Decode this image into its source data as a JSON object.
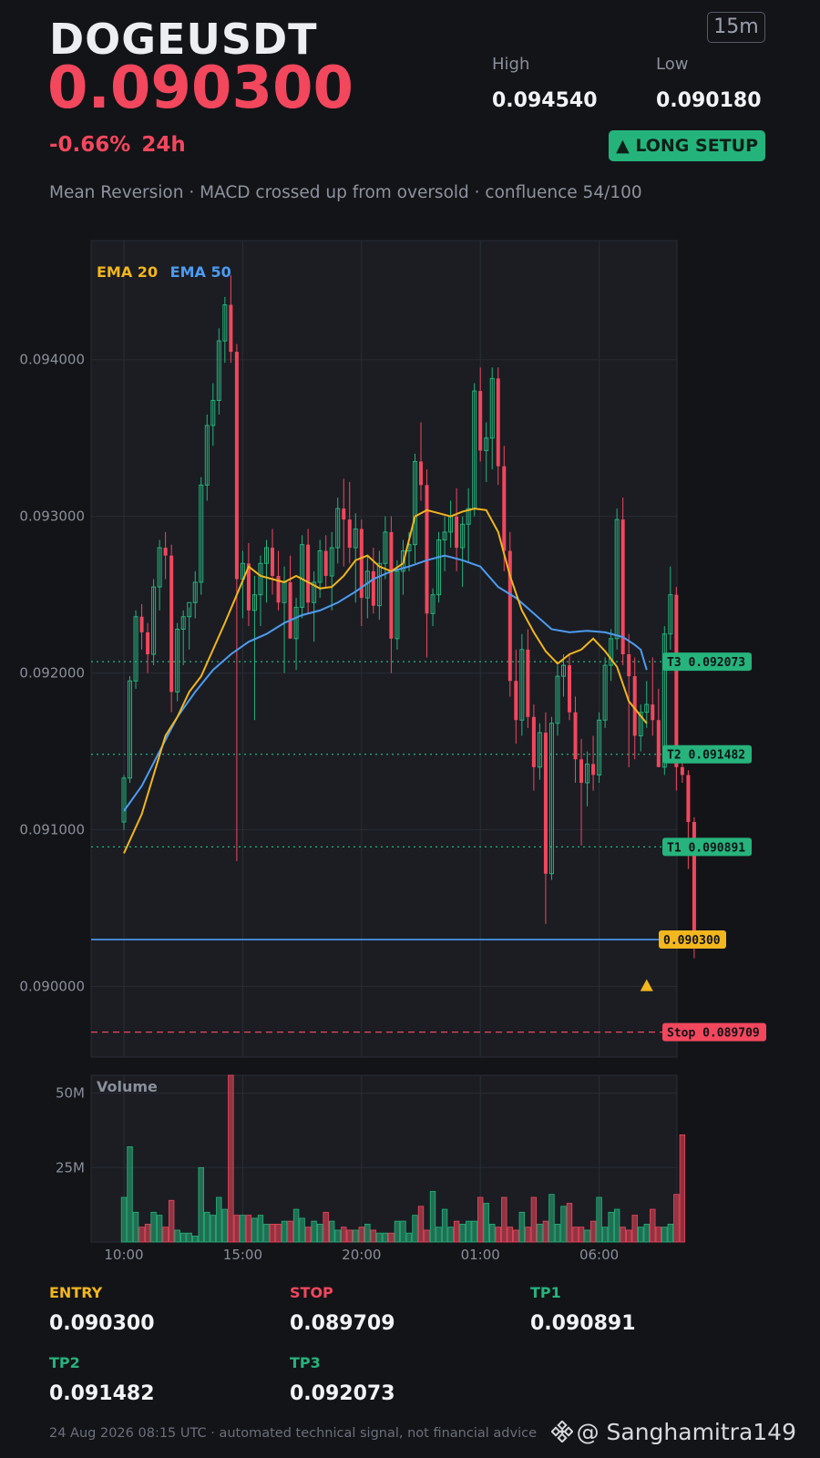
{
  "header": {
    "symbol": "DOGEUSDT",
    "price": "0.090300",
    "change": "-0.66%  24h",
    "timeframe": "15m",
    "high_label": "High",
    "high_value": "0.094540",
    "low_label": "Low",
    "low_value": "0.090180",
    "setup_badge": "▲ LONG SETUP",
    "strategy": "Mean Reversion · MACD crossed up from oversold · confluence 54/100"
  },
  "colors": {
    "up": "#26b37c",
    "down": "#f2475d",
    "ema20": "#f2b61e",
    "ema50": "#4d9cf2",
    "background": "#131418",
    "panel": "#1b1d23"
  },
  "chart_data": {
    "type": "candlestick",
    "y_ticks": [
      0.094,
      0.093,
      0.092,
      0.091,
      0.09
    ],
    "y_tick_labels": [
      "0.094000",
      "0.093000",
      "0.092000",
      "0.091000",
      "0.090000"
    ],
    "ylim": [
      0.08955,
      0.09476
    ],
    "x_tick_labels": [
      "10:00",
      "15:00",
      "20:00",
      "01:00",
      "06:00"
    ],
    "x_tick_index": [
      0,
      20,
      40,
      60,
      80
    ],
    "grid": true,
    "legend": [
      "EMA 20",
      "EMA 50"
    ],
    "candles_ohlc": [
      [
        0.09105,
        0.09135,
        0.091,
        0.09133
      ],
      [
        0.09133,
        0.09198,
        0.0913,
        0.09195
      ],
      [
        0.09195,
        0.0924,
        0.0919,
        0.09236
      ],
      [
        0.09236,
        0.09244,
        0.09215,
        0.09226
      ],
      [
        0.09226,
        0.09232,
        0.092,
        0.09212
      ],
      [
        0.09212,
        0.0926,
        0.09205,
        0.09255
      ],
      [
        0.09255,
        0.09285,
        0.0924,
        0.0928
      ],
      [
        0.0928,
        0.0929,
        0.0926,
        0.09275
      ],
      [
        0.09275,
        0.09282,
        0.09175,
        0.09188
      ],
      [
        0.09188,
        0.09232,
        0.09182,
        0.09228
      ],
      [
        0.09228,
        0.0924,
        0.09205,
        0.09236
      ],
      [
        0.09236,
        0.09242,
        0.09215,
        0.09245
      ],
      [
        0.09245,
        0.09265,
        0.09235,
        0.09258
      ],
      [
        0.09258,
        0.09325,
        0.0925,
        0.0932
      ],
      [
        0.0932,
        0.09365,
        0.0931,
        0.09358
      ],
      [
        0.09358,
        0.09385,
        0.09345,
        0.09374
      ],
      [
        0.09374,
        0.0942,
        0.09365,
        0.09412
      ],
      [
        0.09412,
        0.0944,
        0.09398,
        0.09435
      ],
      [
        0.09435,
        0.09454,
        0.09398,
        0.09405
      ],
      [
        0.09405,
        0.0941,
        0.0908,
        0.0926
      ],
      [
        0.0926,
        0.09278,
        0.09235,
        0.0927
      ],
      [
        0.0927,
        0.09283,
        0.0923,
        0.0924
      ],
      [
        0.0924,
        0.09262,
        0.0917,
        0.0925
      ],
      [
        0.0925,
        0.09275,
        0.0923,
        0.0927
      ],
      [
        0.0927,
        0.09285,
        0.09245,
        0.0928
      ],
      [
        0.0928,
        0.09292,
        0.0925,
        0.09262
      ],
      [
        0.09262,
        0.09278,
        0.0924,
        0.09245
      ],
      [
        0.09245,
        0.09268,
        0.092,
        0.09258
      ],
      [
        0.09258,
        0.09275,
        0.09235,
        0.09222
      ],
      [
        0.09222,
        0.09248,
        0.09202,
        0.09242
      ],
      [
        0.09242,
        0.09288,
        0.09235,
        0.09282
      ],
      [
        0.09282,
        0.09292,
        0.09238,
        0.09245
      ],
      [
        0.09245,
        0.09265,
        0.0922,
        0.09258
      ],
      [
        0.09258,
        0.09285,
        0.09248,
        0.09278
      ],
      [
        0.09278,
        0.09288,
        0.09255,
        0.09262
      ],
      [
        0.09262,
        0.0929,
        0.0924,
        0.0928
      ],
      [
        0.0928,
        0.09312,
        0.0927,
        0.09305
      ],
      [
        0.09305,
        0.09324,
        0.09268,
        0.09298
      ],
      [
        0.09298,
        0.09322,
        0.0927,
        0.0928
      ],
      [
        0.0928,
        0.09302,
        0.09245,
        0.09292
      ],
      [
        0.09292,
        0.09298,
        0.0923,
        0.09248
      ],
      [
        0.09248,
        0.09275,
        0.09235,
        0.09265
      ],
      [
        0.09265,
        0.0928,
        0.09238,
        0.09243
      ],
      [
        0.09243,
        0.09278,
        0.09234,
        0.0927
      ],
      [
        0.0927,
        0.093,
        0.0926,
        0.0929
      ],
      [
        0.0929,
        0.093,
        0.092,
        0.09222
      ],
      [
        0.09222,
        0.09272,
        0.09215,
        0.09265
      ],
      [
        0.09265,
        0.09285,
        0.0925,
        0.09278
      ],
      [
        0.09278,
        0.0929,
        0.09265,
        0.09282
      ],
      [
        0.09282,
        0.0934,
        0.0927,
        0.09335
      ],
      [
        0.09335,
        0.0936,
        0.0931,
        0.0932
      ],
      [
        0.0932,
        0.0933,
        0.0921,
        0.09238
      ],
      [
        0.09238,
        0.09254,
        0.0923,
        0.0925
      ],
      [
        0.0925,
        0.0929,
        0.09245,
        0.09285
      ],
      [
        0.09285,
        0.093,
        0.09265,
        0.0929
      ],
      [
        0.0929,
        0.0931,
        0.0928,
        0.093
      ],
      [
        0.093,
        0.09318,
        0.09265,
        0.0928
      ],
      [
        0.0928,
        0.093,
        0.09255,
        0.09295
      ],
      [
        0.09295,
        0.09318,
        0.0927,
        0.09305
      ],
      [
        0.09305,
        0.09385,
        0.093,
        0.0938
      ],
      [
        0.0938,
        0.09395,
        0.09335,
        0.09342
      ],
      [
        0.09342,
        0.0936,
        0.09322,
        0.0935
      ],
      [
        0.0935,
        0.09395,
        0.0933,
        0.09388
      ],
      [
        0.09388,
        0.09395,
        0.0932,
        0.09332
      ],
      [
        0.09332,
        0.09345,
        0.09265,
        0.09278
      ],
      [
        0.09278,
        0.0929,
        0.09185,
        0.09195
      ],
      [
        0.09195,
        0.09215,
        0.09155,
        0.0917
      ],
      [
        0.0917,
        0.09225,
        0.0916,
        0.09215
      ],
      [
        0.09215,
        0.09228,
        0.09165,
        0.09172
      ],
      [
        0.09172,
        0.0918,
        0.09125,
        0.0914
      ],
      [
        0.0914,
        0.09168,
        0.09132,
        0.09162
      ],
      [
        0.09162,
        0.09175,
        0.0904,
        0.09072
      ],
      [
        0.09072,
        0.09172,
        0.09068,
        0.09168
      ],
      [
        0.09168,
        0.09205,
        0.0916,
        0.09198
      ],
      [
        0.09198,
        0.09212,
        0.09185,
        0.09205
      ],
      [
        0.09205,
        0.09212,
        0.0917,
        0.09175
      ],
      [
        0.09175,
        0.09185,
        0.0913,
        0.09145
      ],
      [
        0.09145,
        0.09158,
        0.0909,
        0.0913
      ],
      [
        0.0913,
        0.0915,
        0.09115,
        0.09142
      ],
      [
        0.09142,
        0.0916,
        0.09125,
        0.09135
      ],
      [
        0.09135,
        0.09175,
        0.0913,
        0.0917
      ],
      [
        0.0917,
        0.0921,
        0.09165,
        0.09205
      ],
      [
        0.09205,
        0.09228,
        0.09195,
        0.09222
      ],
      [
        0.09222,
        0.09305,
        0.09215,
        0.09298
      ],
      [
        0.09298,
        0.09312,
        0.09205,
        0.09212
      ],
      [
        0.09212,
        0.09225,
        0.0914,
        0.09198
      ],
      [
        0.09198,
        0.0921,
        0.09145,
        0.0916
      ],
      [
        0.0916,
        0.0918,
        0.0915,
        0.09175
      ],
      [
        0.09175,
        0.09195,
        0.09165,
        0.0918
      ],
      [
        0.0918,
        0.0921,
        0.0916,
        0.0917
      ],
      [
        0.0917,
        0.0919,
        0.09145,
        0.0914
      ],
      [
        0.0914,
        0.0923,
        0.09135,
        0.09225
      ],
      [
        0.09225,
        0.09268,
        0.09215,
        0.0925
      ],
      [
        0.0925,
        0.09255,
        0.09125,
        0.0914
      ],
      [
        0.0914,
        0.09145,
        0.0913,
        0.09135
      ],
      [
        0.09135,
        0.09138,
        0.09075,
        0.09105
      ],
      [
        0.09105,
        0.09108,
        0.09018,
        0.0903
      ]
    ],
    "ema20": [
      0.09085,
      0.0911,
      0.09135,
      0.0916,
      0.09172,
      0.09188,
      0.09198,
      0.09215,
      0.09232,
      0.0925,
      0.09268,
      0.09262,
      0.0926,
      0.09258,
      0.09262,
      0.09258,
      0.09254,
      0.09255,
      0.09262,
      0.09272,
      0.09275,
      0.09268,
      0.09265,
      0.0927,
      0.093,
      0.09304,
      0.09302,
      0.093,
      0.09303,
      0.09305,
      0.09304,
      0.0929,
      0.09262,
      0.0924,
      0.09226,
      0.09214,
      0.09206,
      0.09212,
      0.09215,
      0.09222,
      0.09214,
      0.09204,
      0.09182,
      0.09168
    ],
    "ema20_x_index": [
      0,
      3,
      5,
      7,
      9,
      11,
      13,
      15,
      17,
      19,
      21,
      23,
      25,
      27,
      29,
      31,
      33,
      35,
      37,
      39,
      41,
      43,
      45,
      47,
      49,
      51,
      53,
      55,
      57,
      59,
      61,
      63,
      65,
      67,
      69,
      71,
      73,
      75,
      77,
      79,
      81,
      83,
      85,
      88
    ],
    "ema50": [
      0.09112,
      0.09128,
      0.0915,
      0.09172,
      0.09188,
      0.09202,
      0.09212,
      0.0922,
      0.09225,
      0.09232,
      0.09237,
      0.0924,
      0.09245,
      0.09252,
      0.0926,
      0.09265,
      0.09268,
      0.09272,
      0.09275,
      0.09272,
      0.09268,
      0.09255,
      0.09248,
      0.09238,
      0.09228,
      0.09226,
      0.09227,
      0.09226,
      0.09223,
      0.09218,
      0.09215,
      0.09202
    ],
    "ema50_x_index": [
      0,
      3,
      6,
      9,
      12,
      15,
      18,
      21,
      24,
      27,
      30,
      33,
      36,
      39,
      42,
      45,
      48,
      51,
      54,
      57,
      60,
      63,
      66,
      69,
      72,
      75,
      78,
      81,
      84,
      86,
      87,
      88
    ],
    "levels": [
      {
        "name": "T3",
        "label": "T3 0.092073",
        "value": 0.092073,
        "style": "dotted",
        "color": "#26b37c"
      },
      {
        "name": "T2",
        "label": "T2 0.091482",
        "value": 0.091482,
        "style": "dotted",
        "color": "#26b37c"
      },
      {
        "name": "T1",
        "label": "T1 0.090891",
        "value": 0.090891,
        "style": "dotted",
        "color": "#26b37c"
      },
      {
        "name": "current",
        "label": "0.090300",
        "value": 0.0903,
        "style": "solid",
        "color": "#4d9cf2",
        "badge_color": "#f2b61e"
      },
      {
        "name": "stop",
        "label": "Stop 0.089709",
        "value": 0.089709,
        "style": "dashed",
        "color": "#f2475d"
      }
    ],
    "signal_marker": {
      "type": "triangle-up",
      "candle_index": 88,
      "value": 0.09,
      "color": "#f2b61e"
    },
    "volume": {
      "label": "Volume",
      "y_ticks": [
        25,
        50
      ],
      "y_tick_labels": [
        "25M",
        "50M"
      ],
      "ylim": [
        0,
        56
      ],
      "values_m": [
        15,
        32,
        10,
        5,
        6,
        10,
        9,
        5,
        14,
        4,
        3,
        3,
        2,
        25,
        10,
        9,
        15,
        11,
        56,
        9,
        9,
        9,
        8,
        9,
        6,
        6,
        6,
        7,
        7,
        11,
        8,
        5,
        7,
        6,
        10,
        7,
        4,
        5,
        4,
        4,
        5,
        6,
        4,
        3,
        3,
        3,
        7,
        7,
        3,
        9,
        12,
        4,
        17,
        5,
        11,
        5,
        7,
        6,
        7,
        7,
        15,
        13,
        6,
        5,
        15,
        5,
        4,
        10,
        5,
        15,
        6,
        7,
        16,
        6,
        12,
        13,
        5,
        5,
        4,
        7,
        15,
        5,
        10,
        11,
        5,
        4,
        9,
        5,
        6,
        11,
        5,
        5,
        6,
        16,
        36
      ]
    }
  },
  "levels_table": [
    {
      "label": "ENTRY",
      "value": "0.090300",
      "color": "#f2b61e"
    },
    {
      "label": "STOP",
      "value": "0.089709",
      "color": "#f2475d"
    },
    {
      "label": "TP1",
      "value": "0.090891",
      "color": "#26b37c"
    },
    {
      "label": "TP2",
      "value": "0.091482",
      "color": "#26b37c"
    },
    {
      "label": "TP3",
      "value": "0.092073",
      "color": "#26b37c"
    }
  ],
  "footer": {
    "timestamp_note": "24 Aug 2026 08:15 UTC  ·  automated technical signal, not financial advice",
    "handle": "@ Sanghamitra149",
    "logo_icon": "binance-logo-icon"
  }
}
